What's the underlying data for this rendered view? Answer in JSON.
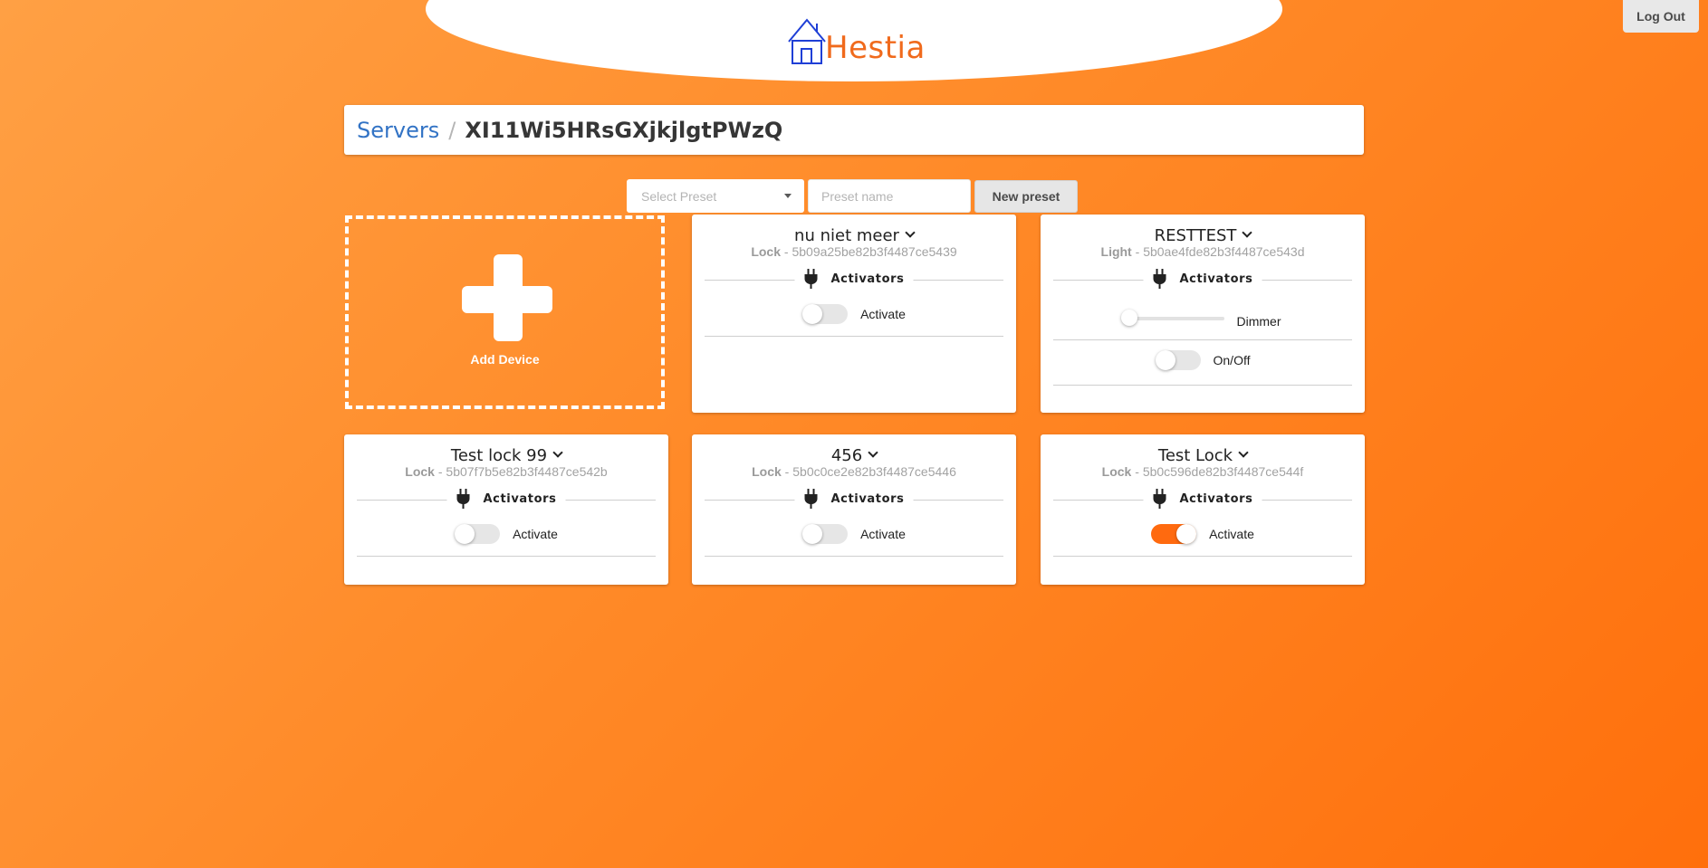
{
  "app": {
    "name": "Hestia"
  },
  "header": {
    "logout_label": "Log Out"
  },
  "breadcrumb": {
    "root": "Servers",
    "separator": "/",
    "current": "XI11Wi5HRsGXjkjlgtPWzQ"
  },
  "presets": {
    "select_placeholder": "Select Preset",
    "name_placeholder": "Preset name",
    "new_button": "New preset"
  },
  "add_device": {
    "label": "Add Device"
  },
  "devices": [
    {
      "name": "nu niet meer",
      "type": "Lock",
      "id": "5b09a25be82b3f4487ce5439",
      "section": "Activators",
      "controls": [
        {
          "kind": "toggle",
          "label": "Activate",
          "on": false
        }
      ]
    },
    {
      "name": "RESTTEST",
      "type": "Light",
      "id": "5b0ae4fde82b3f4487ce543d",
      "section": "Activators",
      "controls": [
        {
          "kind": "slider",
          "label": "Dimmer",
          "value": 0
        },
        {
          "kind": "toggle",
          "label": "On/Off",
          "on": false
        }
      ]
    },
    {
      "name": "Test lock 99",
      "type": "Lock",
      "id": "5b07f7b5e82b3f4487ce542b",
      "section": "Activators",
      "controls": [
        {
          "kind": "toggle",
          "label": "Activate",
          "on": false
        }
      ]
    },
    {
      "name": "456",
      "type": "Lock",
      "id": "5b0c0ce2e82b3f4487ce5446",
      "section": "Activators",
      "controls": [
        {
          "kind": "toggle",
          "label": "Activate",
          "on": false
        }
      ]
    },
    {
      "name": "Test Lock",
      "type": "Lock",
      "id": "5b0c596de82b3f4487ce544f",
      "section": "Activators",
      "controls": [
        {
          "kind": "toggle",
          "label": "Activate",
          "on": true
        }
      ]
    }
  ],
  "colors": {
    "accent": "#ff6a0f",
    "link": "#3273c5",
    "logo_text": "#f06a1c",
    "logo_house": "#1f3fd6"
  }
}
